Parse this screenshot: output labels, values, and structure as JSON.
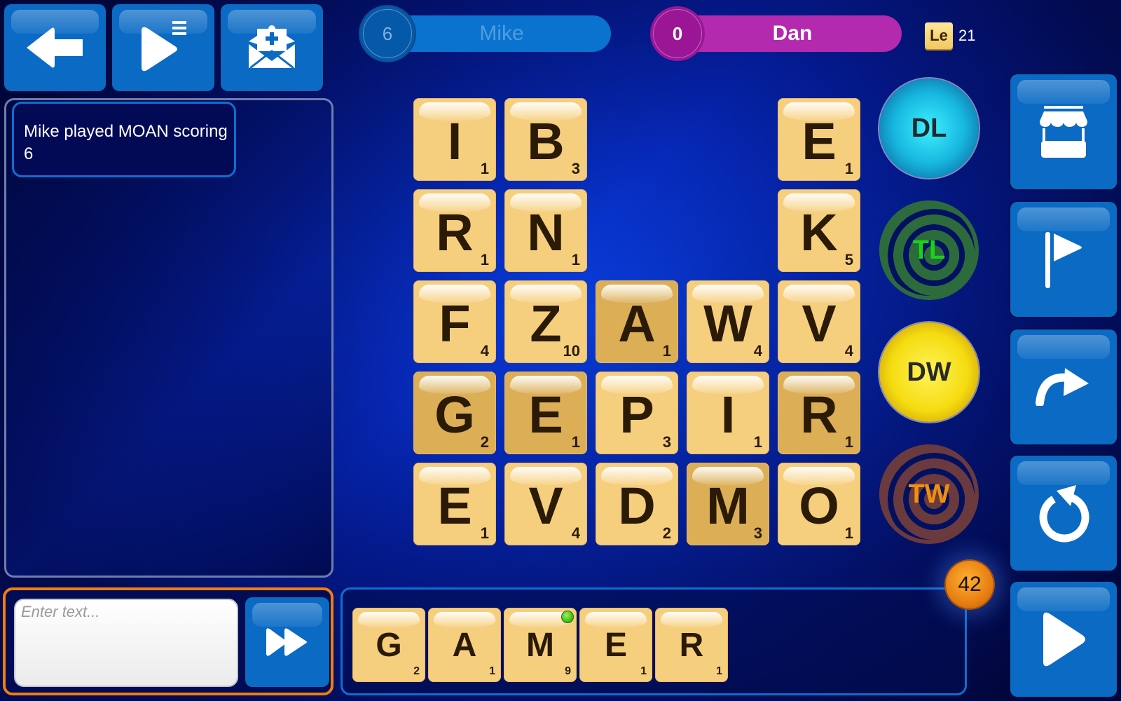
{
  "toolbar": {
    "back_icon": "arrow-left-icon",
    "play_list_icon": "play-list-icon",
    "invite_icon": "mail-invite-icon"
  },
  "players": [
    {
      "name": "Mike",
      "score": "6",
      "color": "#0a72cf",
      "active": false
    },
    {
      "name": "Dan",
      "score": "0",
      "color": "#b32aae",
      "active": true
    }
  ],
  "letters_left": {
    "label": "Le",
    "count": "21"
  },
  "chat": {
    "messages": [
      {
        "text": "Mike played MOAN scoring 6"
      }
    ],
    "input_placeholder": "Enter text...",
    "input_value": "",
    "send_icon": "fast-forward-icon"
  },
  "board": {
    "rows": [
      [
        {
          "letter": "I",
          "points": "1",
          "dark": false
        },
        {
          "letter": "B",
          "points": "3",
          "dark": false
        },
        null,
        null,
        {
          "letter": "E",
          "points": "1",
          "dark": false
        }
      ],
      [
        {
          "letter": "R",
          "points": "1",
          "dark": false
        },
        {
          "letter": "N",
          "points": "1",
          "dark": false
        },
        null,
        null,
        {
          "letter": "K",
          "points": "5",
          "dark": false
        }
      ],
      [
        {
          "letter": "F",
          "points": "4",
          "dark": false
        },
        {
          "letter": "Z",
          "points": "10",
          "dark": false
        },
        {
          "letter": "A",
          "points": "1",
          "dark": true
        },
        {
          "letter": "W",
          "points": "4",
          "dark": false
        },
        {
          "letter": "V",
          "points": "4",
          "dark": false
        }
      ],
      [
        {
          "letter": "G",
          "points": "2",
          "dark": true
        },
        {
          "letter": "E",
          "points": "1",
          "dark": true
        },
        {
          "letter": "P",
          "points": "3",
          "dark": false
        },
        {
          "letter": "I",
          "points": "1",
          "dark": false
        },
        {
          "letter": "R",
          "points": "1",
          "dark": true
        }
      ],
      [
        {
          "letter": "E",
          "points": "1",
          "dark": false
        },
        {
          "letter": "V",
          "points": "4",
          "dark": false
        },
        {
          "letter": "D",
          "points": "2",
          "dark": false
        },
        {
          "letter": "M",
          "points": "3",
          "dark": true
        },
        {
          "letter": "O",
          "points": "1",
          "dark": false
        }
      ]
    ]
  },
  "bonuses": [
    {
      "label": "DL",
      "name": "double-letter"
    },
    {
      "label": "TL",
      "name": "triple-letter"
    },
    {
      "label": "DW",
      "name": "double-word"
    },
    {
      "label": "TW",
      "name": "triple-word"
    }
  ],
  "rack": {
    "tiles": [
      {
        "letter": "G",
        "points": "2",
        "marker": false
      },
      {
        "letter": "A",
        "points": "1",
        "marker": false
      },
      {
        "letter": "M",
        "points": "9",
        "marker": true
      },
      {
        "letter": "E",
        "points": "1",
        "marker": false
      },
      {
        "letter": "R",
        "points": "1",
        "marker": false
      }
    ],
    "tiles_remaining": "42"
  },
  "side_buttons": [
    {
      "name": "shop",
      "icon": "shop-icon"
    },
    {
      "name": "resign",
      "icon": "flag-icon"
    },
    {
      "name": "pass",
      "icon": "redo-arrow-icon"
    },
    {
      "name": "shuffle",
      "icon": "refresh-icon"
    },
    {
      "name": "play",
      "icon": "play-icon"
    }
  ]
}
